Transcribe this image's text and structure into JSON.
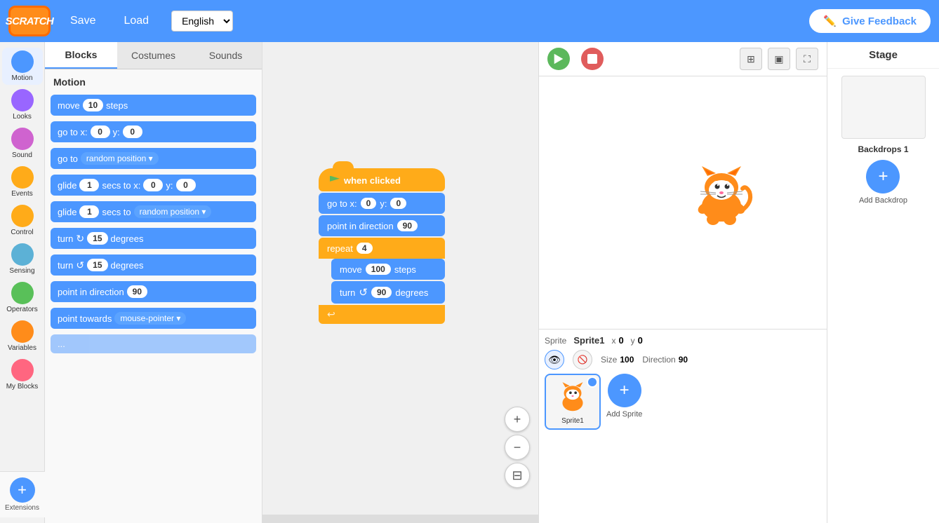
{
  "header": {
    "logo": "SCRATCH",
    "save_label": "Save",
    "load_label": "Load",
    "language": "English",
    "feedback_label": "Give Feedback"
  },
  "tabs": {
    "blocks_label": "Blocks",
    "costumes_label": "Costumes",
    "sounds_label": "Sounds"
  },
  "blocks_panel": {
    "header": "Motion",
    "blocks": [
      {
        "text": "move",
        "value": "10",
        "suffix": "steps"
      },
      {
        "text": "go to x:",
        "x": "0",
        "y_label": "y:",
        "y": "0"
      },
      {
        "text": "go to",
        "dropdown": "random position"
      },
      {
        "text": "glide",
        "value": "1",
        "middle": "secs to x:",
        "x": "0",
        "y_label": "y:",
        "y": "0"
      },
      {
        "text": "glide",
        "value": "1",
        "middle": "secs to",
        "dropdown": "random position"
      },
      {
        "text": "turn",
        "dir": "↻",
        "value": "15",
        "suffix": "degrees"
      },
      {
        "text": "turn",
        "dir": "↺",
        "value": "15",
        "suffix": "degrees"
      },
      {
        "text": "point in direction",
        "value": "90"
      },
      {
        "text": "point towards",
        "dropdown": "mouse-pointer"
      }
    ]
  },
  "categories": [
    {
      "label": "Motion",
      "color": "#4C97FF"
    },
    {
      "label": "Looks",
      "color": "#9966FF"
    },
    {
      "label": "Sound",
      "color": "#CF63CF"
    },
    {
      "label": "Events",
      "color": "#FFAB19"
    },
    {
      "label": "Control",
      "color": "#FFAB19"
    },
    {
      "label": "Sensing",
      "color": "#5CB1D6"
    },
    {
      "label": "Operators",
      "color": "#59C059"
    },
    {
      "label": "Variables",
      "color": "#FF8C1A"
    },
    {
      "label": "My Blocks",
      "color": "#FF6680"
    }
  ],
  "extensions_label": "Extensions",
  "script": {
    "hat": "when clicked",
    "flag_label": "🏁",
    "blocks": [
      {
        "type": "motion",
        "text": "go to x:",
        "x": "0",
        "y": "0"
      },
      {
        "type": "motion",
        "text": "point in direction",
        "val": "90"
      },
      {
        "type": "control",
        "text": "repeat",
        "val": "4"
      },
      {
        "type": "motion",
        "text": "move",
        "val": "100",
        "suffix": "steps",
        "indent": true
      },
      {
        "type": "motion",
        "text": "turn",
        "dir": "↺",
        "val": "90",
        "suffix": "degrees",
        "indent": true
      }
    ]
  },
  "zoom": {
    "in_label": "+",
    "out_label": "−",
    "fit_label": "⊟"
  },
  "stage": {
    "green_flag_title": "Green Flag",
    "stop_title": "Stop",
    "sprite_label": "Sprite",
    "sprite_name": "Sprite1",
    "x_label": "x",
    "x_val": "0",
    "y_label": "y",
    "y_val": "0",
    "size_label": "Size",
    "size_val": "100",
    "direction_label": "Direction",
    "direction_val": "90",
    "stage_label": "Stage",
    "backdrops_label": "Backdrops",
    "backdrops_val": "1",
    "add_sprite_label": "Add Sprite",
    "add_backdrop_label": "Add Backdrop"
  }
}
